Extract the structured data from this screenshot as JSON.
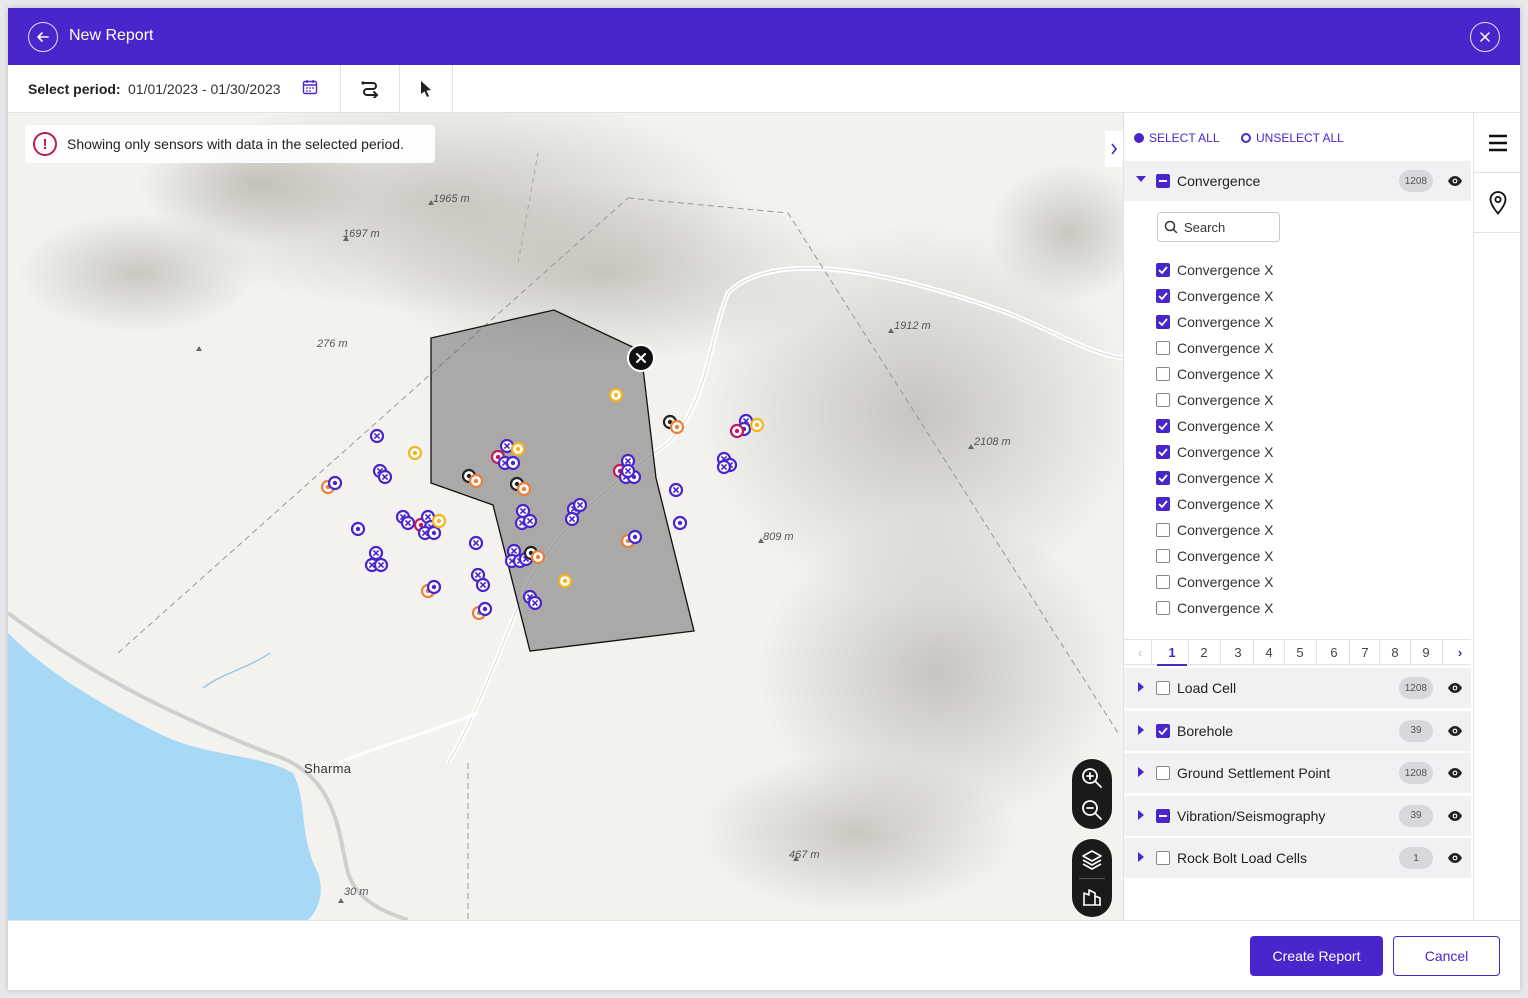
{
  "header": {
    "title": "New Report",
    "back_icon": "arrow-left-icon",
    "close_icon": "close-icon"
  },
  "toolbar": {
    "period_label": "Select period:",
    "period_value": "01/01/2023 - 01/30/2023"
  },
  "map": {
    "notice": "Showing only  sensors with data in the selected period.",
    "elevations": [
      "1965 m",
      "1697 m",
      "276 m",
      "1912 m",
      "2108 m",
      "809 m",
      "467 m",
      "30 m"
    ],
    "place": "Sharma"
  },
  "panel": {
    "select_all": "SELECT ALL",
    "unselect_all": "UNSELECT ALL",
    "search_placeholder": "Search",
    "groups": [
      {
        "label": "Convergence",
        "count": "1208",
        "state": "partial",
        "expanded": true
      },
      {
        "label": "Load Cell",
        "count": "1208",
        "state": "unchecked"
      },
      {
        "label": "Borehole",
        "count": "39",
        "state": "checked"
      },
      {
        "label": "Ground Settlement Point",
        "count": "1208",
        "state": "unchecked"
      },
      {
        "label": "Vibration/Seismography",
        "count": "39",
        "state": "partial"
      },
      {
        "label": "Rock Bolt Load Cells",
        "count": "1",
        "state": "unchecked"
      }
    ],
    "items": [
      {
        "label": "Convergence X",
        "checked": true
      },
      {
        "label": "Convergence X",
        "checked": true
      },
      {
        "label": "Convergence X",
        "checked": true
      },
      {
        "label": "Convergence X",
        "checked": false
      },
      {
        "label": "Convergence X",
        "checked": false
      },
      {
        "label": "Convergence X",
        "checked": false
      },
      {
        "label": "Convergence X",
        "checked": true
      },
      {
        "label": "Convergence X",
        "checked": true
      },
      {
        "label": "Convergence X",
        "checked": true
      },
      {
        "label": "Convergence X",
        "checked": true
      },
      {
        "label": "Convergence X",
        "checked": false
      },
      {
        "label": "Convergence X",
        "checked": false
      },
      {
        "label": "Convergence X",
        "checked": false
      },
      {
        "label": "Convergence X",
        "checked": false
      }
    ],
    "pages": [
      "1",
      "2",
      "3",
      "4",
      "5",
      "6",
      "7",
      "8",
      "9"
    ],
    "current_page": "1"
  },
  "footer": {
    "create_label": "Create Report",
    "cancel_label": "Cancel"
  },
  "colors": {
    "accent": "#4a25cc",
    "warning": "#c2185b",
    "polygon": "#8a8a8a",
    "sensor_purple": "#4a25cc",
    "sensor_orange": "#e8803a",
    "sensor_yellow": "#f2b51b",
    "sensor_black": "#222222",
    "sensor_red": "#c2185b"
  }
}
